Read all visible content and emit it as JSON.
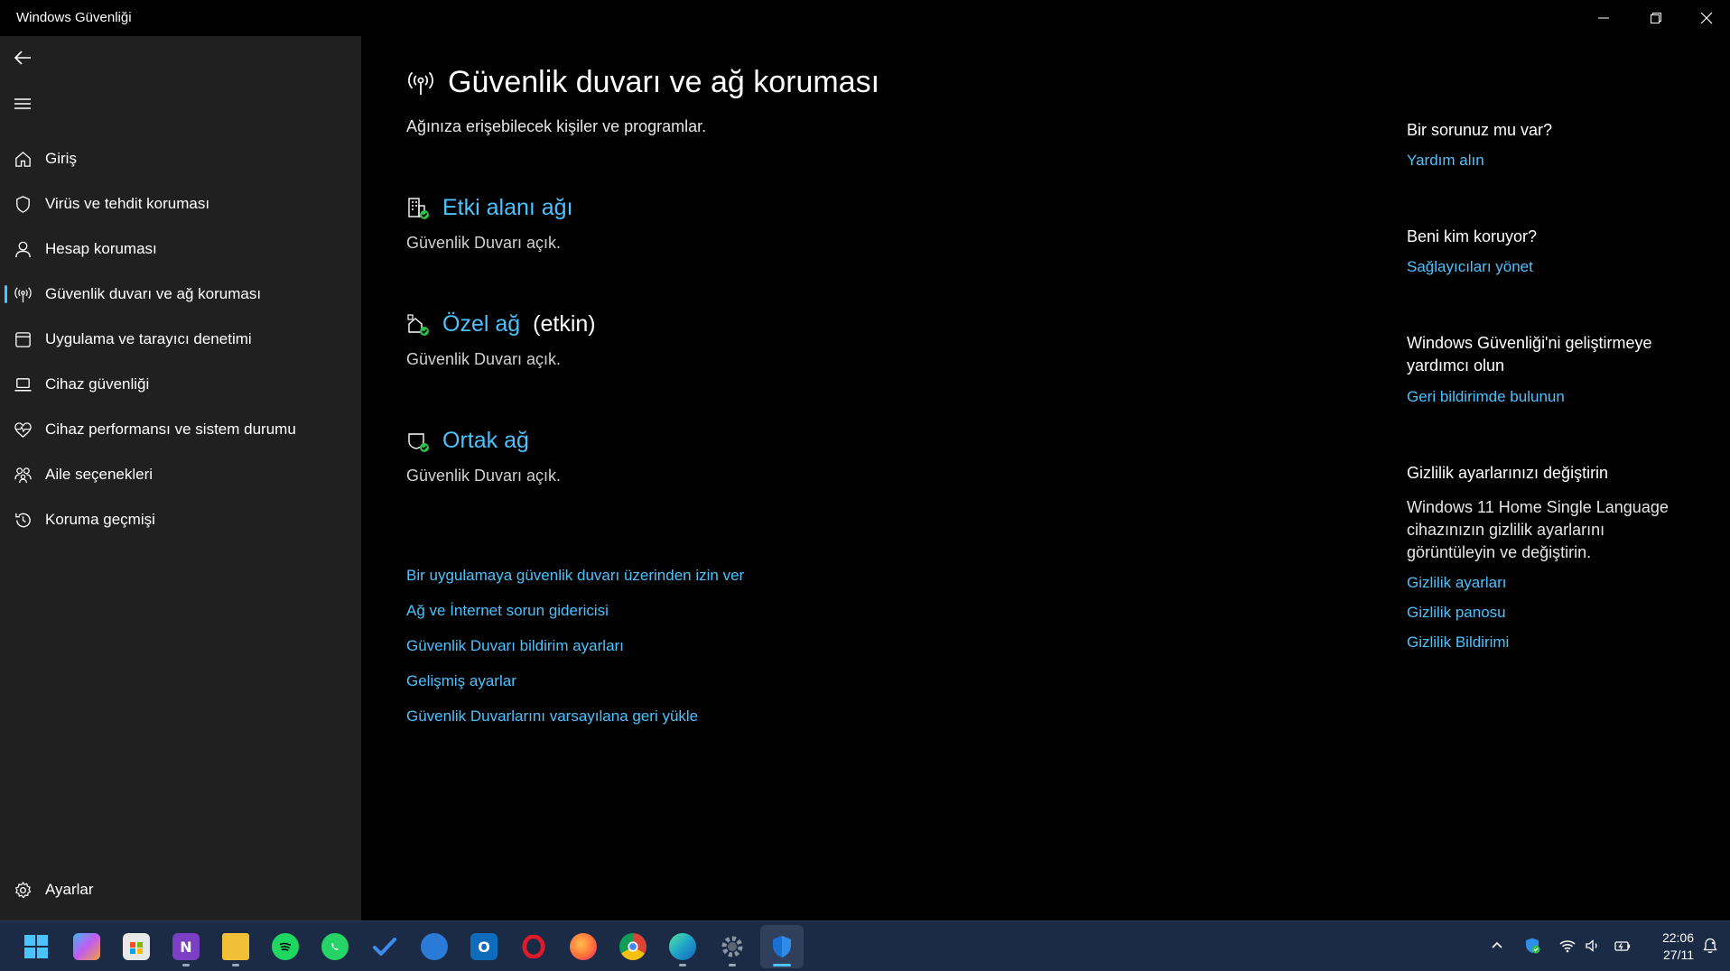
{
  "window": {
    "title": "Windows Güvenliği"
  },
  "sidebar": {
    "items": [
      {
        "label": "Giriş"
      },
      {
        "label": "Virüs ve tehdit koruması"
      },
      {
        "label": "Hesap koruması"
      },
      {
        "label": "Güvenlik duvarı ve ağ koruması",
        "active": true
      },
      {
        "label": "Uygulama ve tarayıcı denetimi"
      },
      {
        "label": "Cihaz güvenliği"
      },
      {
        "label": "Cihaz performansı ve sistem durumu"
      },
      {
        "label": "Aile seçenekleri"
      },
      {
        "label": "Koruma geçmişi"
      }
    ],
    "settings_label": "Ayarlar"
  },
  "main": {
    "title": "Güvenlik duvarı ve ağ koruması",
    "subtitle": "Ağınıza erişebilecek kişiler ve programlar.",
    "networks": [
      {
        "name": "Etki alanı ağı",
        "active_label": "",
        "status": "Güvenlik Duvarı açık."
      },
      {
        "name": "Özel ağ",
        "active_label": "(etkin)",
        "status": "Güvenlik Duvarı açık."
      },
      {
        "name": "Ortak ağ",
        "active_label": "",
        "status": "Güvenlik Duvarı açık."
      }
    ],
    "links": [
      "Bir uygulamaya güvenlik duvarı üzerinden izin ver",
      "Ağ ve İnternet sorun gidericisi",
      "Güvenlik Duvarı bildirim ayarları",
      "Gelişmiş ayarlar",
      "Güvenlik Duvarlarını varsayılana geri yükle"
    ]
  },
  "right": {
    "help_heading": "Bir sorunuz mu var?",
    "help_link": "Yardım alın",
    "protect_heading": "Beni kim koruyor?",
    "protect_link": "Sağlayıcıları yönet",
    "improve_heading": "Windows Güvenliği'ni geliştirmeye yardımcı olun",
    "improve_link": "Geri bildirimde bulunun",
    "privacy_heading": "Gizlilik ayarlarınızı değiştirin",
    "privacy_text": "Windows 11 Home Single Language cihazınızın gizlilik ayarlarını görüntüleyin ve değiştirin.",
    "privacy_links": [
      "Gizlilik ayarları",
      "Gizlilik panosu",
      "Gizlilik Bildirimi"
    ]
  },
  "taskbar": {
    "apps": [
      {
        "name": "start-icon",
        "color": "#4cc2ff"
      },
      {
        "name": "copilot-icon",
        "color": "#c25cf0"
      },
      {
        "name": "store-icon",
        "color": "#e8e8e8"
      },
      {
        "name": "onenote-icon",
        "color": "#7b3fc4"
      },
      {
        "name": "file-explorer-icon",
        "color": "#f2c036"
      },
      {
        "name": "spotify-icon",
        "color": "#1ed760"
      },
      {
        "name": "whatsapp-icon",
        "color": "#25d366"
      },
      {
        "name": "todo-icon",
        "color": "#3c8cf0"
      },
      {
        "name": "edge-beta-icon",
        "color": "#2a7ad8"
      },
      {
        "name": "outlook-icon",
        "color": "#0f6cbd"
      },
      {
        "name": "opera-icon",
        "color": "#e01a2b"
      },
      {
        "name": "firefox-icon",
        "color": "#ff7139"
      },
      {
        "name": "chrome-icon",
        "color": "#e9b523"
      },
      {
        "name": "edge-icon",
        "color": "#1fa4c9"
      },
      {
        "name": "settings-icon",
        "color": "#8a94a3"
      },
      {
        "name": "windows-security-icon",
        "color": "#2f8ce8",
        "active": true
      }
    ],
    "clock_time": "22:06",
    "clock_date": "27/11"
  },
  "colors": {
    "accent": "#4cc2ff",
    "sidebar_bg": "#202020",
    "main_bg": "#000000",
    "taskbar_bg": "#1c2b45",
    "status_ok": "#2fbf4a"
  }
}
